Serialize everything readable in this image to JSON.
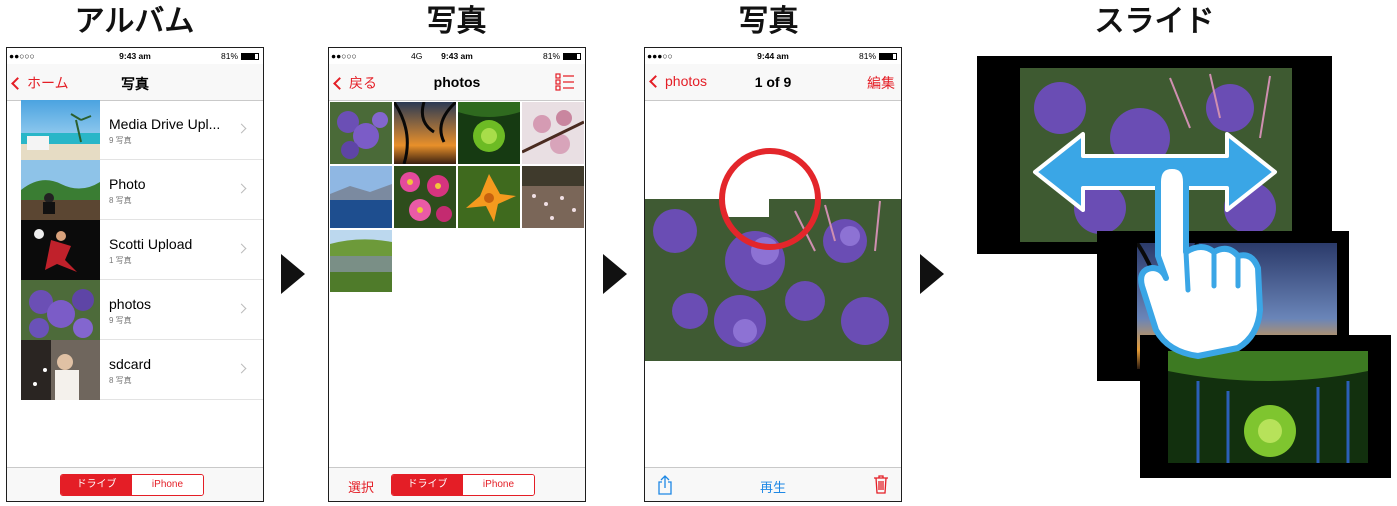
{
  "headings": [
    "アルバム",
    "写真",
    "写真",
    "スライド"
  ],
  "screen1": {
    "status": {
      "carrier": "●●○○○",
      "time": "9:43 am",
      "battery": "81%"
    },
    "back_label": "ホーム",
    "title": "写真",
    "albums": [
      {
        "name": "Media Drive Upl...",
        "count": "9 写真"
      },
      {
        "name": "Photo",
        "count": "8 写真"
      },
      {
        "name": "Scotti Upload",
        "count": "1 写真"
      },
      {
        "name": "photos",
        "count": "9 写真"
      },
      {
        "name": "sdcard",
        "count": "8 写真"
      }
    ],
    "segment": [
      "ドライブ",
      "iPhone"
    ]
  },
  "screen2": {
    "status": {
      "carrier": "●●○○○",
      "network": "4G",
      "time": "9:43 am",
      "battery": "81%"
    },
    "back_label": "戻る",
    "title": "photos",
    "select_label": "選択",
    "segment": [
      "ドライブ",
      "iPhone"
    ]
  },
  "screen3": {
    "status": {
      "carrier": "●●●○○",
      "time": "9:44 am",
      "battery": "81%"
    },
    "back_label": "photos",
    "title": "1 of 9",
    "edit_label": "編集",
    "play_label": "再生"
  },
  "colors": {
    "accent": "#e41e26",
    "ios_blue": "#1e88e5",
    "slide_arrow": "#3aa6e6",
    "circle": "#e3262b"
  }
}
